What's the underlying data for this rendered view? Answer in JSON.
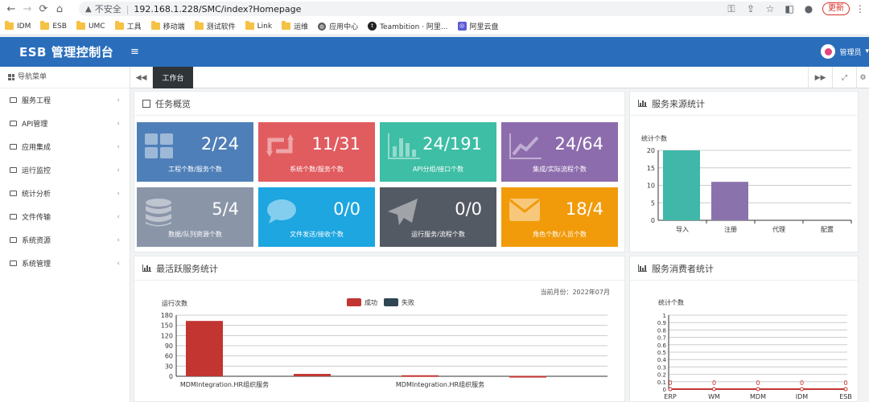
{
  "browser": {
    "insecure": "不安全",
    "url": "192.168.1.228/SMC/index?Homepage",
    "update": "更新",
    "bookmarks": [
      {
        "label": "IDM",
        "icon": "folder"
      },
      {
        "label": "ESB",
        "icon": "folder"
      },
      {
        "label": "UMC",
        "icon": "folder"
      },
      {
        "label": "工具",
        "icon": "folder"
      },
      {
        "label": "移动端",
        "icon": "folder"
      },
      {
        "label": "测试软件",
        "icon": "folder"
      },
      {
        "label": "Link",
        "icon": "folder"
      },
      {
        "label": "运维",
        "icon": "folder"
      },
      {
        "label": "应用中心",
        "icon": "globe"
      },
      {
        "label": "Teambition · 阿里...",
        "icon": "teambition"
      },
      {
        "label": "阿里云盘",
        "icon": "aliyun"
      }
    ]
  },
  "header": {
    "brand": "ESB 管理控制台",
    "user": "管理员"
  },
  "sidebar": {
    "title": "导航菜单",
    "items": [
      "服务工程",
      "API管理",
      "应用集成",
      "运行监控",
      "统计分析",
      "文件传输",
      "系统资源",
      "系统管理"
    ]
  },
  "tabs": {
    "active": "工作台"
  },
  "overview": {
    "title": "任务概览",
    "tiles": [
      {
        "value": "2/24",
        "label": "工程个数/服务个数",
        "color": "#4f7fb8",
        "icon": "grid"
      },
      {
        "value": "11/31",
        "label": "系统个数/服务个数",
        "color": "#e15c5f",
        "icon": "retweet"
      },
      {
        "value": "24/191",
        "label": "API分组/接口个数",
        "color": "#3dbea5",
        "icon": "barchart"
      },
      {
        "value": "24/64",
        "label": "集成/实际流程个数",
        "color": "#8d6cad",
        "icon": "linechart"
      },
      {
        "value": "5/4",
        "label": "数据/队列资源个数",
        "color": "#8a95a8",
        "icon": "database"
      },
      {
        "value": "0/0",
        "label": "文件发送/接收个数",
        "color": "#1da6e0",
        "icon": "chat"
      },
      {
        "value": "0/0",
        "label": "运行服务/流程个数",
        "color": "#535a63",
        "icon": "plane"
      },
      {
        "value": "18/4",
        "label": "角色个数/人员个数",
        "color": "#f19b0b",
        "icon": "mail"
      }
    ]
  },
  "active_title": "最活跃服务统计",
  "source_title": "服务来源统计",
  "consumer_title": "服务消费者统计",
  "month_label": "当前月份：2022年07月",
  "chart_data": [
    {
      "type": "bar",
      "title": "服务来源统计",
      "ylabel": "统计个数",
      "categories": [
        "导入",
        "注册",
        "代理",
        "配置"
      ],
      "values": [
        20,
        11,
        0,
        0
      ],
      "colors": [
        "#40b7a8",
        "#8a73ad",
        "#40b7a8",
        "#40b7a8"
      ],
      "ylim": [
        0,
        20
      ],
      "yticks": [
        "20",
        "15",
        "10",
        "5",
        "0"
      ]
    },
    {
      "type": "bar",
      "title": "最活跃服务统计",
      "ylabel": "运行次数",
      "categories": [
        "MDMIntegration.HR组织服务",
        "",
        "MDMIntegration.HR组织服务",
        ""
      ],
      "series": [
        {
          "name": "成功",
          "color": "#c23531",
          "values": [
            163,
            7,
            3,
            1
          ]
        },
        {
          "name": "失败",
          "color": "#2f4554",
          "values": [
            0,
            0,
            0,
            0
          ]
        }
      ],
      "ylim": [
        0,
        180
      ],
      "yticks": [
        "180",
        "150",
        "120",
        "90",
        "60",
        "30",
        "0"
      ]
    },
    {
      "type": "line",
      "title": "服务消费者统计",
      "ylabel": "统计个数",
      "categories": [
        "ERP",
        "WM",
        "MDM",
        "IDM",
        "ESB"
      ],
      "values": [
        0,
        0,
        0,
        0,
        0
      ],
      "data_labels": [
        "0",
        "0",
        "0",
        "0",
        "0"
      ],
      "color": "#c23531",
      "ylim": [
        0,
        1
      ],
      "yticks": [
        "1",
        "0.9",
        "0.8",
        "0.7",
        "0.6",
        "0.5",
        "0.4",
        "0.3",
        "0.2",
        "0.1",
        "0"
      ]
    }
  ]
}
